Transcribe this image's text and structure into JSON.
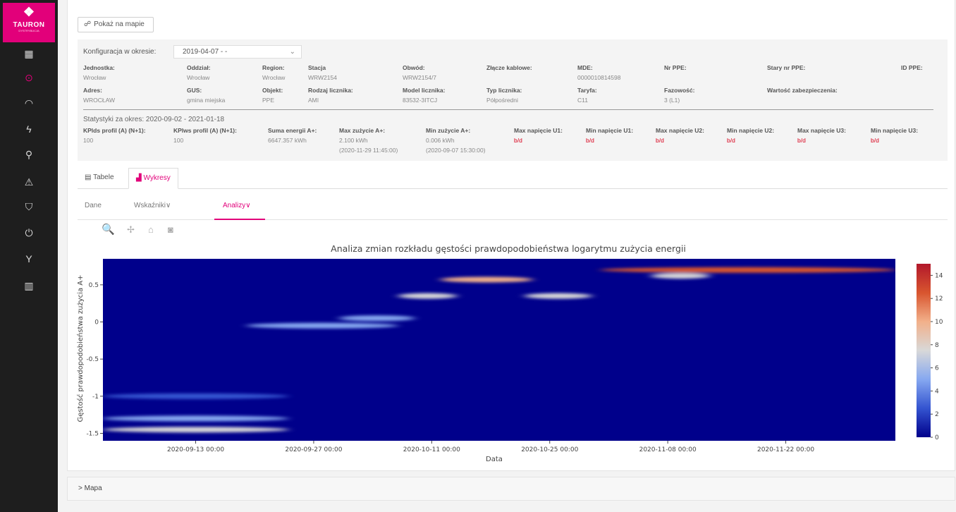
{
  "brand": {
    "mark": "❖",
    "name": "TAURON",
    "sub": "DYSTRYBUCJA"
  },
  "nav_icons": [
    {
      "name": "grid-icon",
      "glyph": "▦"
    },
    {
      "name": "meter-icon",
      "glyph": "⊙"
    },
    {
      "name": "gauge-icon",
      "glyph": "◠"
    },
    {
      "name": "lightning-icon",
      "glyph": "ϟ"
    },
    {
      "name": "location-pin-icon",
      "glyph": "⚲"
    },
    {
      "name": "warning-icon",
      "glyph": "⚠"
    },
    {
      "name": "shield-icon",
      "glyph": "⛉"
    },
    {
      "name": "power-icon",
      "glyph": "⏻"
    },
    {
      "name": "network-icon",
      "glyph": "Y"
    },
    {
      "name": "map-icon",
      "glyph": "▥"
    }
  ],
  "show_map_button": {
    "icon": "☍",
    "label": "Pokaż na mapie"
  },
  "config": {
    "label": "Konfiguracja w okresie:",
    "selected": "2019-04-07 - -",
    "chevron": "⌄"
  },
  "fields": {
    "jednostka": {
      "label": "Jednostka:",
      "value": "Wrocław"
    },
    "oddzial": {
      "label": "Oddział:",
      "value": "Wrocław"
    },
    "region": {
      "label": "Region:",
      "value": "Wrocław"
    },
    "stacja": {
      "label": "Stacja",
      "value": "WRW2154"
    },
    "obwod": {
      "label": "Obwód:",
      "value": "WRW2154/7"
    },
    "zlacze": {
      "label": "Złącze kablowe:",
      "value": ""
    },
    "mde": {
      "label": "MDE:",
      "value": "0000010814598"
    },
    "nr_ppe": {
      "label": "Nr PPE:",
      "value": ""
    },
    "stary_ppe": {
      "label": "Stary nr PPE:",
      "value": ""
    },
    "id_ppe": {
      "label": "ID PPE:",
      "value": ""
    },
    "adres": {
      "label": "Adres:",
      "value": "WROCŁAW"
    },
    "gus": {
      "label": "GUS:",
      "value": "gmina miejska"
    },
    "obiekt": {
      "label": "Objekt:",
      "value": "PPE"
    },
    "rodzaj": {
      "label": "Rodzaj licznika:",
      "value": "AMI"
    },
    "model": {
      "label": "Model licznika:",
      "value": "83532-3ITCJ"
    },
    "typ": {
      "label": "Typ licznika:",
      "value": "Półpośredni"
    },
    "taryfa": {
      "label": "Taryfa:",
      "value": "C11"
    },
    "fazowosc": {
      "label": "Fazowość:",
      "value": "3 (L1)"
    },
    "zabezpieczenie": {
      "label": "Wartość zabezpieczenia:",
      "value": ""
    }
  },
  "stats": {
    "label": "Statystyki za okres: 2020-09-02 - 2021-01-18",
    "items": {
      "kplds": {
        "label": "KPlds profil (A) (N+1):",
        "value": "100"
      },
      "kplws": {
        "label": "KPlws profil (A) (N+1):",
        "value": "100"
      },
      "suma": {
        "label": "Suma energii A+:",
        "value": "6647.357 kWh"
      },
      "max_zuzycie": {
        "label": "Max zużycie A+:",
        "value": "2.100 kWh",
        "value2": "(2020-11-29 11:45:00)"
      },
      "min_zuzycie": {
        "label": "Min zużycie A+:",
        "value": "0.006 kWh",
        "value2": "(2020-09-07 15:30:00)"
      },
      "max_u1": {
        "label": "Max napięcie U1:",
        "value": "b/d"
      },
      "min_u1": {
        "label": "Min napięcie U1:",
        "value": "b/d"
      },
      "max_u2": {
        "label": "Max napięcie U2:",
        "value": "b/d"
      },
      "min_u2": {
        "label": "Min napięcie U2:",
        "value": "b/d"
      },
      "max_u3": {
        "label": "Max napięcie U3:",
        "value": "b/d"
      },
      "min_u3": {
        "label": "Min napięcie U3:",
        "value": "b/d"
      }
    }
  },
  "tabs": [
    {
      "icon": "▤",
      "label": "Tabele"
    },
    {
      "icon": "▟",
      "label": "Wykresy"
    }
  ],
  "subtabs": {
    "dane": "Dane",
    "wskazniki": "Wskaźniki∨",
    "analizy": "Analizy∨"
  },
  "toolbar": {
    "zoom": "🔍",
    "pan": "✢",
    "home": "⌂",
    "camera": "◙"
  },
  "mapa": {
    "label": "> Mapa"
  },
  "chart_data": {
    "type": "heatmap",
    "title": "Analiza zmian rozkładu gęstości prawdopodobieństwa logarytmu zużycia energii",
    "xlabel": "Data",
    "ylabel": "Gęstość prawdopodobieństwa zużycia A+",
    "x_ticks": [
      "2020-09-13 00:00",
      "2020-09-27 00:00",
      "2020-10-11 00:00",
      "2020-10-25 00:00",
      "2020-11-08 00:00",
      "2020-11-22 00:00"
    ],
    "x_range": [
      "2020-09-02",
      "2020-12-05"
    ],
    "y_ticks": [
      0.5,
      0,
      -0.5,
      -1,
      -1.5
    ],
    "ylim": [
      -1.6,
      0.85
    ],
    "colorbar_ticks": [
      0,
      2,
      4,
      6,
      8,
      10,
      12,
      14
    ],
    "colorbar_range": [
      0,
      15
    ],
    "colorscale": [
      "#00008b",
      "#3454d0",
      "#86a8f0",
      "#d8d8d8",
      "#f2b08a",
      "#d8552f",
      "#b2182b"
    ],
    "hotspots": [
      {
        "x_start": "2020-09-02",
        "x_end": "2020-09-24",
        "y": -1.45,
        "intensity": 7
      },
      {
        "x_start": "2020-09-02",
        "x_end": "2020-09-24",
        "y": -1.3,
        "intensity": 4
      },
      {
        "x_start": "2020-09-02",
        "x_end": "2020-09-24",
        "y": -1.0,
        "intensity": 3
      },
      {
        "x_start": "2020-09-19",
        "x_end": "2020-10-07",
        "y": -0.05,
        "intensity": 5
      },
      {
        "x_start": "2020-09-30",
        "x_end": "2020-10-09",
        "y": 0.05,
        "intensity": 4
      },
      {
        "x_start": "2020-10-07",
        "x_end": "2020-10-14",
        "y": 0.35,
        "intensity": 7
      },
      {
        "x_start": "2020-10-12",
        "x_end": "2020-10-23",
        "y": 0.57,
        "intensity": 10
      },
      {
        "x_start": "2020-10-22",
        "x_end": "2020-10-30",
        "y": 0.35,
        "intensity": 8
      },
      {
        "x_start": "2020-10-31",
        "x_end": "2020-12-05",
        "y": 0.7,
        "intensity": 13
      },
      {
        "x_start": "2020-11-06",
        "x_end": "2020-11-13",
        "y": 0.62,
        "intensity": 7
      }
    ]
  }
}
